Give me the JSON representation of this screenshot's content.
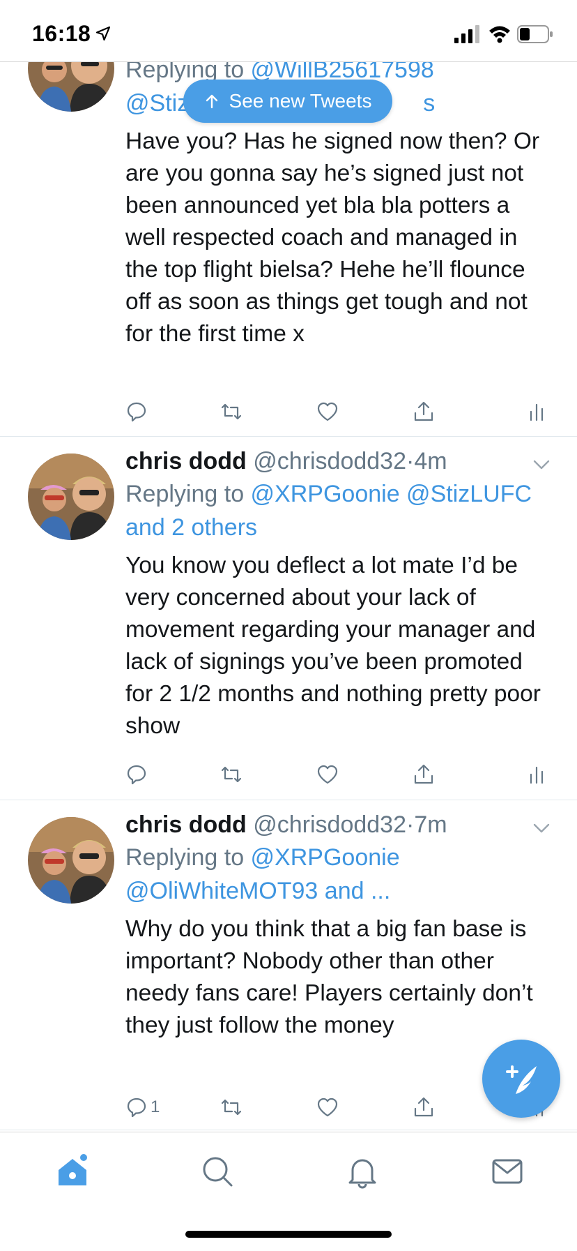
{
  "status_bar": {
    "time": "16:18"
  },
  "pill": {
    "label": "See new Tweets"
  },
  "tweets": [
    {
      "replying_prefix": "Replying to ",
      "reply_line1": "@WillB25617598",
      "reply_line2_visible": "@Stiz",
      "reply_line2_tail": "s",
      "text": "Have you? Has he signed now then? Or are you gonna say he’s signed just not been announced yet bla bla potters a well respected coach and managed in the top flight bielsa? Hehe he’ll flounce off as soon as things get tough and not for the first time x"
    },
    {
      "name": "chris dodd",
      "handle": "@chrisdodd32",
      "dot": "·",
      "time": "4m",
      "replying_prefix": "Replying to ",
      "reply_to": "@XRPGoonie @StizLUFC and 2 others",
      "text": "You know you deflect a lot mate I’d be very concerned about your lack of movement regarding your manager and lack of signings you’ve been promoted for 2 1/2 months and nothing pretty poor show"
    },
    {
      "name": "chris dodd",
      "handle": "@chrisdodd32",
      "dot": "·",
      "time": "7m",
      "replying_prefix": "Replying to ",
      "reply_to": "@XRPGoonie @OliWhiteMOT93 and ...",
      "text": "Why do you think that a big fan base is important? Nobody other than other needy fans care! Players certainly don’t they just follow the money",
      "reply_count": "1"
    }
  ],
  "tabs": [
    "home",
    "search",
    "notifications",
    "messages"
  ],
  "colors": {
    "accent": "#4a9ee6",
    "link": "#3e95e0",
    "muted": "#657786",
    "text": "#14171a"
  }
}
